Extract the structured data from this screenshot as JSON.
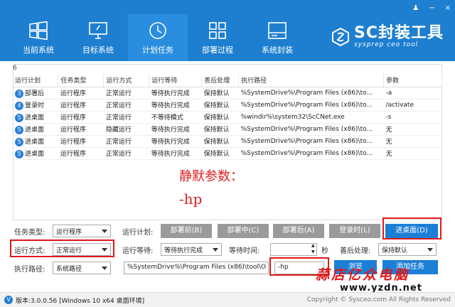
{
  "window": {
    "help_icon": "help-icon",
    "minimize": "−",
    "close": "×"
  },
  "nav": [
    {
      "label": "当前系统",
      "icon": "windows-icon"
    },
    {
      "label": "目标系统",
      "icon": "monitor-icon"
    },
    {
      "label": "计划任务",
      "icon": "clock-icon"
    },
    {
      "label": "部署过程",
      "icon": "grid-icon"
    },
    {
      "label": "系统封装",
      "icon": "drive-icon"
    }
  ],
  "brand": {
    "title": "SC封装工具",
    "subtitle": "sysprep ceo tool"
  },
  "task_count": "6",
  "table": {
    "headers": [
      "运行计划",
      "任务类型",
      "运行方式",
      "运行等待",
      "善后处理",
      "执行路径",
      "参数"
    ],
    "rows": [
      {
        "badge": "3",
        "plan": "部署后",
        "type": "运行程序",
        "mode": "正常运行",
        "wait": "等待执行完成",
        "after": "保持默认",
        "path": "%SystemDrive%\\Program Files (x86)\\to...",
        "param": "-a"
      },
      {
        "badge": "4",
        "plan": "登录时",
        "type": "运行程序",
        "mode": "正常运行",
        "wait": "等待执行完成",
        "after": "保持默认",
        "path": "%SystemDrive%\\Program Files (x86)\\to...",
        "param": "/activate"
      },
      {
        "badge": "5",
        "plan": "进桌面",
        "type": "运行程序",
        "mode": "正常运行",
        "wait": "不等待模式",
        "after": "保持默认",
        "path": "%windir%\\system32\\ScCNet.exe",
        "param": " -s"
      },
      {
        "badge": "5",
        "plan": "进桌面",
        "type": "运行程序",
        "mode": "隐藏运行",
        "wait": "等待执行完成",
        "after": "保持默认",
        "path": "%SystemDrive%\\Program Files (x86)\\to...",
        "param": "无"
      },
      {
        "badge": "5",
        "plan": "进桌面",
        "type": "运行程序",
        "mode": "正常运行",
        "wait": "等待执行完成",
        "after": "保持默认",
        "path": "%SystemDrive%\\Program Files (x86)\\to...",
        "param": "无"
      },
      {
        "badge": "5",
        "plan": "进桌面",
        "type": "运行程序",
        "mode": "正常运行",
        "wait": "等待执行完成",
        "after": "保持默认",
        "path": "%SystemDrive%\\Program Files (x86)\\to...",
        "param": "无"
      }
    ]
  },
  "annotation": {
    "line1": "静默参数：",
    "line2": "-hp"
  },
  "form": {
    "task_type_label": "任务类型:",
    "task_type_value": "运行程序",
    "run_plan_label": "运行计划:",
    "plan_buttons": [
      "部署前(B)",
      "部署中(C)",
      "部署后(A)",
      "登录时(L)",
      "进桌面(D)"
    ],
    "run_mode_label": "运行方式:",
    "run_mode_value": "正常运行",
    "run_wait_label": "运行等待:",
    "run_wait_value": "等待执行完成",
    "wait_time_label": "等待时间:",
    "wait_time_value": "",
    "wait_time_unit": "秒",
    "after_label": "善后处理:",
    "after_value": "保持默认",
    "exec_path_label": "执行路径:",
    "exec_path_type": "系统路径",
    "exec_path_value": "%SystemDrive%\\Program Files (x86)\\tool\\O",
    "param_value": "-hp",
    "browse_button": "浏览",
    "add_button": "添加任务"
  },
  "status": {
    "version": "版本:3.0.0.56 [Windows 10 x64 桌面环境]",
    "copyright": "Copyright © Sysceo.com All Rights Reserved"
  },
  "watermark": {
    "line1": "蒜店亿众电脑",
    "line2": "www.yzdn.net"
  },
  "colors": {
    "header": "#1e7fd0",
    "accent": "#1c7fd6",
    "highlight": "#e01818"
  }
}
